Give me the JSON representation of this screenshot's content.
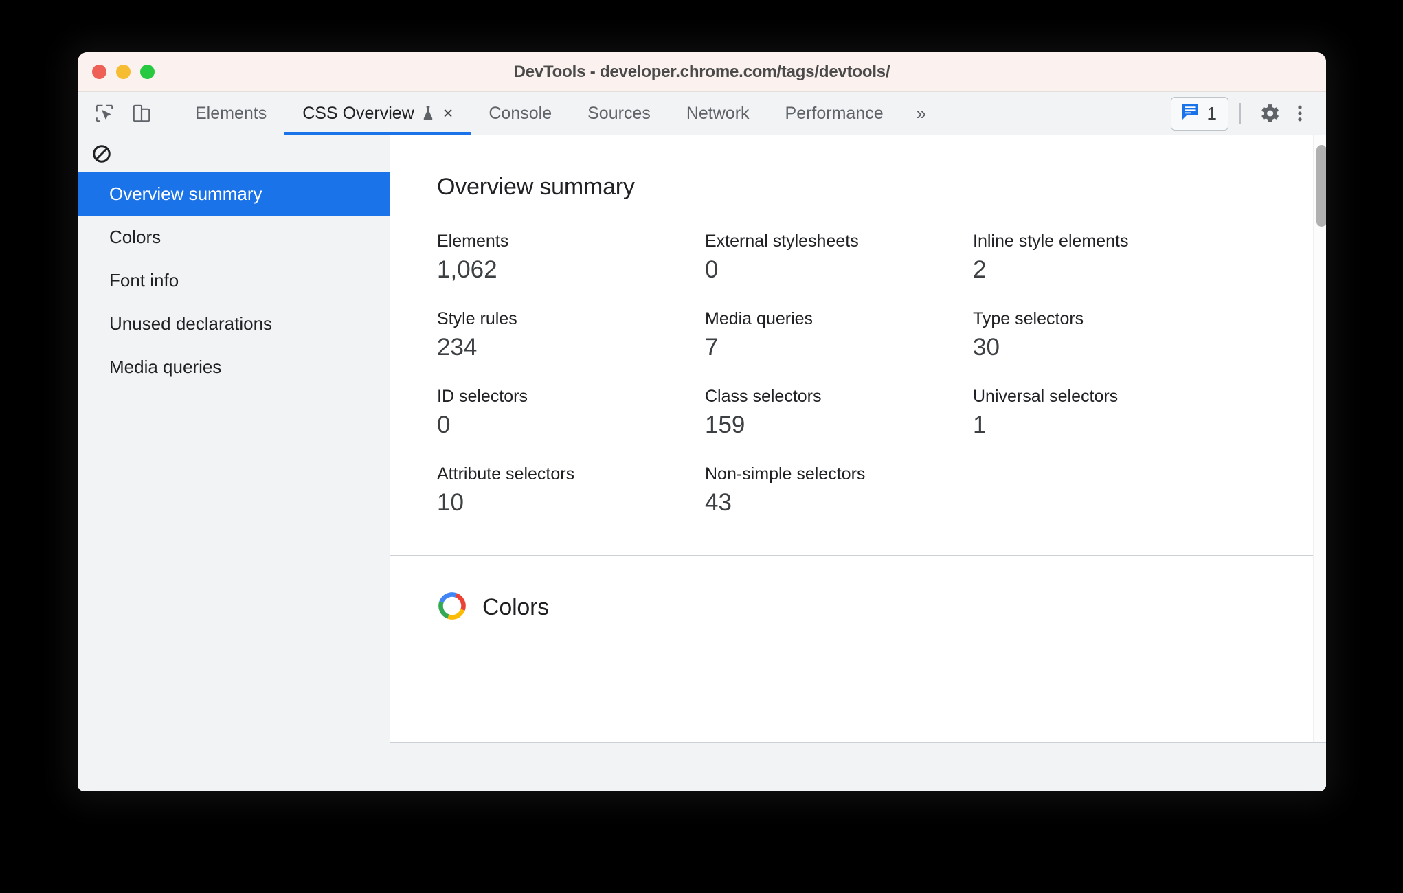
{
  "window": {
    "title": "DevTools - developer.chrome.com/tags/devtools/",
    "traffic_lights": [
      {
        "name": "close",
        "color": "#ee5f56"
      },
      {
        "name": "minimize",
        "color": "#f6bd33"
      },
      {
        "name": "zoom",
        "color": "#26c940"
      }
    ]
  },
  "toolbar": {
    "inspect_icon": "inspect-cursor-icon",
    "device_icon": "device-toolbar-icon",
    "tabs": [
      {
        "label": "Elements",
        "active": false
      },
      {
        "label": "CSS Overview",
        "active": true,
        "flask": true,
        "closable": true
      },
      {
        "label": "Console",
        "active": false
      },
      {
        "label": "Sources",
        "active": false
      },
      {
        "label": "Network",
        "active": false
      },
      {
        "label": "Performance",
        "active": false
      }
    ],
    "overflow_label": "»",
    "close_label": "×",
    "messages_count": "1",
    "messages_icon": "console-message-icon",
    "settings_icon": "gear-icon",
    "more_icon": "three-dot-menu-icon",
    "accent_color": "#1a73e8"
  },
  "sidebar": {
    "clear_icon": "block-clear-icon",
    "items": [
      {
        "label": "Overview summary",
        "selected": true
      },
      {
        "label": "Colors",
        "selected": false
      },
      {
        "label": "Font info",
        "selected": false
      },
      {
        "label": "Unused declarations",
        "selected": false
      },
      {
        "label": "Media queries",
        "selected": false
      }
    ]
  },
  "main": {
    "title": "Overview summary",
    "stats": [
      {
        "label": "Elements",
        "value": "1,062"
      },
      {
        "label": "External stylesheets",
        "value": "0"
      },
      {
        "label": "Inline style elements",
        "value": "2"
      },
      {
        "label": "Style rules",
        "value": "234"
      },
      {
        "label": "Media queries",
        "value": "7"
      },
      {
        "label": "Type selectors",
        "value": "30"
      },
      {
        "label": "ID selectors",
        "value": "0"
      },
      {
        "label": "Class selectors",
        "value": "159"
      },
      {
        "label": "Universal selectors",
        "value": "1"
      },
      {
        "label": "Attribute selectors",
        "value": "10"
      },
      {
        "label": "Non-simple selectors",
        "value": "43"
      },
      {
        "label": "",
        "value": ""
      }
    ],
    "colors_section": {
      "title": "Colors",
      "icon": "color-wheel-icon",
      "wheel_colors": [
        "#4285f4",
        "#ea4335",
        "#fbbc05",
        "#34a853"
      ]
    }
  }
}
